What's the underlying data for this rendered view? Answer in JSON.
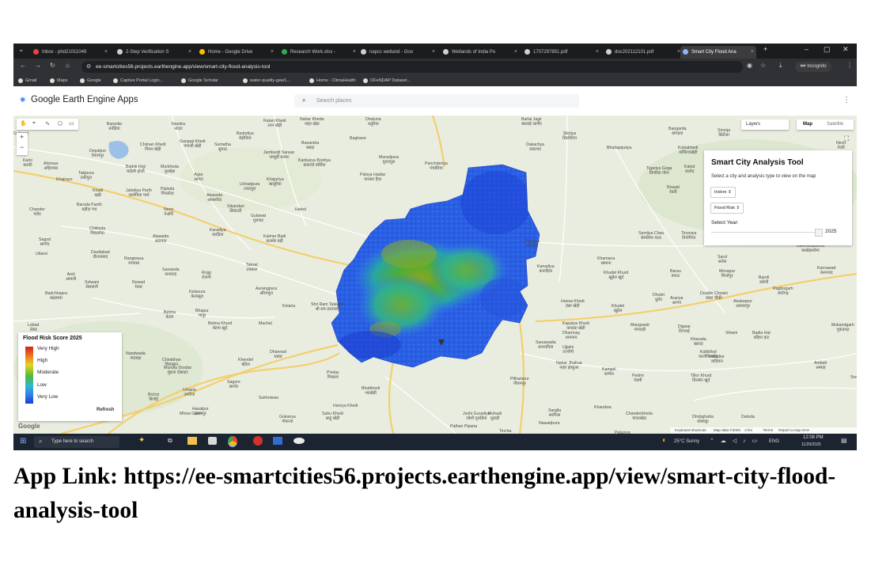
{
  "browser": {
    "tabs": [
      {
        "label": "Inbox - phd21011049",
        "icon_color": "#e8453c"
      },
      {
        "label": "2-Step Verification S",
        "icon_color": "#d0d0d0"
      },
      {
        "label": "Home - Google Drive",
        "icon_color": "#fbbc04"
      },
      {
        "label": "Research Work.xlsx -",
        "icon_color": "#34a853"
      },
      {
        "label": "napcc wetland - Goo",
        "icon_color": "#d0d0d0"
      },
      {
        "label": "Wetlands of India Po",
        "icon_color": "#d0d0d0"
      },
      {
        "label": "1707297851.pdf",
        "icon_color": "#d0d0d0"
      },
      {
        "label": "doc202112101.pdf",
        "icon_color": "#d0d0d0"
      },
      {
        "label": "Smart City Flood Ana",
        "icon_color": "#8ab4f8"
      }
    ],
    "url": "ee-smartcities56.projects.earthengine.app/view/smart-city-flood-analysis-tool",
    "incognito_label": "Incognito",
    "bookmarks": [
      "Gmail",
      "Maps",
      "Google",
      "Captive Portal Login...",
      "Google Scholar",
      "water-quality-gee/L...",
      "Home - ClimaHealth",
      "OFeNDAP Dataset..."
    ]
  },
  "app": {
    "title": "Google Earth Engine Apps",
    "search_placeholder": "Search places",
    "map_type": {
      "map": "Map",
      "satellite": "Satellite"
    },
    "layers_label": "Layers"
  },
  "panel": {
    "title": "Smart City Analysis Tool",
    "subtitle": "Select a city and analysis type to view on the map",
    "city": "Indore",
    "analysis": "Flood Risk",
    "year_label": "Select Year:",
    "year_value": "2025"
  },
  "legend": {
    "title": "Flood Risk Score 2025",
    "labels": [
      "Very High",
      "High",
      "Moderate",
      "Low",
      "Very Low"
    ],
    "refresh_label": "Refresh"
  },
  "map_footer": {
    "shortcuts": "Keyboard shortcuts",
    "data": "Map data ©2025",
    "scale": "2 km",
    "terms": "Terms",
    "report": "Report a map error"
  },
  "map_labels": [
    {
      "t": "Banedia\nबनेड़िया"
    },
    {
      "t": "Nandra\nनांदरा"
    },
    {
      "t": "Ratan Khedi\nरतन खेड़ी"
    },
    {
      "t": "Nahar Kheda\nनाहर खेड़ा"
    },
    {
      "t": "Dhaturia\nधतूरिया"
    },
    {
      "t": "Barlai Jagir\nबरलाई जागीर"
    },
    {
      "t": "Bangarda\nबांगड़दा"
    },
    {
      "t": "Sironja\nसिरोंजा"
    },
    {
      "t": "Chiman Khedi\nचिमन खेड़ी"
    },
    {
      "t": "Gangaji Khedi\nगंगाजी खेड़ी"
    },
    {
      "t": "Sumatha\nसुमठा"
    },
    {
      "t": "Bedodiya\nबेड़ोडिया"
    },
    {
      "t": "Basandra\nबसंद्रा"
    },
    {
      "t": "Baghane"
    },
    {
      "t": "Dakachya\nडकाच्या"
    },
    {
      "t": "Silotiya\nसिलोटिया"
    },
    {
      "t": "Nevri\nनेवरी"
    },
    {
      "t": "Depalpur\nदेपालपुर"
    },
    {
      "t": "Karki\nकरकी"
    },
    {
      "t": "Ahirwas\nअहिरवास"
    },
    {
      "t": "Jamburdi Sarwar\nजम्बूर्डी सरवर"
    },
    {
      "t": "Kankarya Bordiya\nकंकार्या बोर्डिया"
    },
    {
      "t": "Muradpura\nमुरादपुरा"
    },
    {
      "t": "Panchderiya\nपंचडेरिया"
    },
    {
      "t": "Bhadapipalya"
    },
    {
      "t": "Kokiakhedi\nकोकियाखेड़ी"
    },
    {
      "t": "Takipura\nटकीपुरा"
    },
    {
      "t": "Badoli Hoji\nबदोली होजी"
    },
    {
      "t": "Murkheda\nमुरखेड़ा"
    },
    {
      "t": "Agra\nआगरा"
    },
    {
      "t": "Khajuriya\nखजूरिया"
    },
    {
      "t": "Palsya Haidar\nपाल्स्या हैदर"
    },
    {
      "t": "Tigariya Goga\nतिगरिया गोगा"
    },
    {
      "t": "Kalod\nकलोद"
    },
    {
      "t": "Khajrayo"
    },
    {
      "t": "Uchadpura\nउचदपुरा"
    },
    {
      "t": "Rewati\nरेवती"
    },
    {
      "t": "Khadi\nखड़ी"
    },
    {
      "t": "Jalodiya Parth\nजलोदिया पार्थ"
    },
    {
      "t": "Piploda\nपिपलोदा"
    },
    {
      "t": "Akasoda\nआकसोदा"
    },
    {
      "t": "Baroda Panth\nबड़ौदा पंथ"
    },
    {
      "t": "Chander\nचांदेर"
    },
    {
      "t": "Neori\nनेओरी"
    },
    {
      "t": "Sikandari\nसिकंदरी"
    },
    {
      "t": "Hatod"
    },
    {
      "t": "Gulawat\nगुलावट"
    },
    {
      "t": "Chikloda\nचिकलोदा"
    },
    {
      "t": "Karadiya\nकरड़िया"
    },
    {
      "t": "Kalmer Badi\nकलमेर बड़ी"
    },
    {
      "t": "Semliya Chau\nसेमलिया चाऊ"
    },
    {
      "t": "Tinoniya\nतिनोनिया"
    },
    {
      "t": "Sagod\nसागोद"
    },
    {
      "t": "Atawada\nअटावदा"
    },
    {
      "t": "Palariya\nपालरिया"
    },
    {
      "t": "Barkhedasoma\nबरखेड़ासोमा"
    },
    {
      "t": "Uttarsi"
    },
    {
      "t": "Daultabad\nदौलताबाद"
    },
    {
      "t": "Rangwasa\nरंगवासा"
    },
    {
      "t": "Khamana\nखमाना"
    },
    {
      "t": "Sarol\nसरोल"
    },
    {
      "t": "Kanadiya\nकनाड़िया"
    },
    {
      "t": "Amli\nआमली"
    },
    {
      "t": "Sanawda\nसनावदा"
    },
    {
      "t": "Rojgi\nरोजगी"
    },
    {
      "t": "Khudel Khurd\nखुड़ेल खुर्द"
    },
    {
      "t": "Barau\nबराऊ"
    },
    {
      "t": "Mirzapur\nमिर्जापुर"
    },
    {
      "t": "Karnawad\nकरनावद"
    },
    {
      "t": "Selwani\nसेलवानी"
    },
    {
      "t": "Rewad\nरेवाड"
    },
    {
      "t": "Badchhapra\nबड़छपरा"
    },
    {
      "t": "Kelasura\nकेलासुरा"
    },
    {
      "t": "Aurangpura\nऔरंगपुरा"
    },
    {
      "t": "Baroli\nबरोली"
    },
    {
      "t": "Raghogarh\nराघोगढ़"
    },
    {
      "t": "Dhulet\nधुलेट"
    },
    {
      "t": "Aranya\nअरण्य"
    },
    {
      "t": "Double Chowki\nडबल चौकी"
    },
    {
      "t": "Akabarpur\nअकबरपुर"
    },
    {
      "t": "Shri Ram Talawali\nश्री राम तलावली"
    },
    {
      "t": "Kelaria"
    },
    {
      "t": "Hansa Khedi\nहंसा खेड़ी"
    },
    {
      "t": "Khudel\nखुड़ेल"
    },
    {
      "t": "Betma\nबेटमा"
    },
    {
      "t": "Bhapur\nभापुर"
    },
    {
      "t": "Betma Khurd\nबेटमा खुर्द"
    },
    {
      "t": "Machal"
    },
    {
      "t": "Lebad\nलेबड"
    },
    {
      "t": "Kapatya Khedi\nकपट्या खेड़ी"
    },
    {
      "t": "Mangwadi\nमंगवाड़ी"
    },
    {
      "t": "Digwai\nदिगवाई"
    },
    {
      "t": "Mukandgarh\nमुकंदगढ़"
    },
    {
      "t": "Dhamnay\nधामनाय"
    },
    {
      "t": "Shiwni"
    },
    {
      "t": "Badia Hat\nबड़िया हाट"
    },
    {
      "t": "Kharada\nखरादा"
    },
    {
      "t": "Sanawadia\nसनावदिया"
    },
    {
      "t": "Ujjaini\nउज्जैनी"
    },
    {
      "t": "Nandwada\nनंदवाड़ा"
    },
    {
      "t": "Dhannad\nधन्नाड"
    },
    {
      "t": "Chirakhan\nचिराखान"
    },
    {
      "t": "Khendel\nखेंदेल"
    },
    {
      "t": "Kalibillod\nकालीबिल्लोद"
    },
    {
      "t": "Mundla Dosdar\nमुंडला दोसदार"
    },
    {
      "t": "Nahar Jhabua\nनाहर झाबुआ"
    },
    {
      "t": "Ambah\nअम्बाह"
    },
    {
      "t": "Someway"
    },
    {
      "t": "Pivday\nपिवडाय"
    },
    {
      "t": "Kampel\nकम्पेल"
    },
    {
      "t": "Pedmi\nपेडमी"
    },
    {
      "t": "Tillor Khurd\nतिल्लोर खुर्द"
    },
    {
      "t": "Pithampur\nपीथमपुर"
    },
    {
      "t": "Sagore\nसागोर"
    },
    {
      "t": "Bichoi\nबिचोई"
    },
    {
      "t": "Umaria\nउमरिया"
    },
    {
      "t": "Bhatkhedi\nभटखेड़ी"
    },
    {
      "t": "Sukhniwas"
    },
    {
      "t": "Hasalpur\nहसलपुर"
    },
    {
      "t": "Harnya Khedi"
    },
    {
      "t": "Sahu Khedi\nसाहू खेड़ी"
    },
    {
      "t": "Khandwa"
    },
    {
      "t": "Mhow Gaon"
    },
    {
      "t": "Gokanya\nगोकन्या"
    },
    {
      "t": "Joshi Guradiya\nजोशी गुराड़िया"
    },
    {
      "t": "Muhadi\nमुहाड़ी"
    },
    {
      "t": "Sargila\nसरगिला"
    },
    {
      "t": "Chanderkheda\nचांदरखेड़ा"
    },
    {
      "t": "Dhobghatta\nधोबघट्टा"
    },
    {
      "t": "Datoda"
    },
    {
      "t": "Pathan Piparia"
    },
    {
      "t": "Tincha"
    },
    {
      "t": "Nawadpura"
    },
    {
      "t": "Palasiya\nपलासिया"
    },
    {
      "t": "mbadiar\nबाड़ियार"
    },
    {
      "t": "Gulawat"
    },
    {
      "t": "Taksal\nटकसल"
    }
  ],
  "taskbar": {
    "search_placeholder": "Type here to search",
    "weather": "25°C  Sunny",
    "lang": "ENG",
    "time": "12:08 PM",
    "date": "11/29/2025"
  },
  "caption": "App Link: https://ee-smartcities56.projects.earthengine.app/view/smart-city-flood-analysis-tool",
  "colors": {
    "risk_very_low": "#1a3cd8",
    "risk_low": "#2f7fe6",
    "risk_moderate": "#27b09a",
    "risk_high": "#7ab52c",
    "risk_very_high": "#d42020",
    "map_bg": "#eaeee2",
    "road": "#ffffff",
    "highway": "#f6d37a"
  },
  "icons": [
    "chrome-menu-icon",
    "back-icon",
    "forward-icon",
    "reload-icon",
    "home-icon",
    "eye-off-icon",
    "star-icon",
    "download-icon",
    "search-icon",
    "more-vert-icon",
    "fullscreen-icon",
    "zoom-in-icon",
    "zoom-out-icon",
    "hand-tool-icon",
    "marker-icon",
    "line-icon",
    "polygon-icon",
    "rectangle-icon",
    "windows-start-icon",
    "copilot-icon"
  ]
}
